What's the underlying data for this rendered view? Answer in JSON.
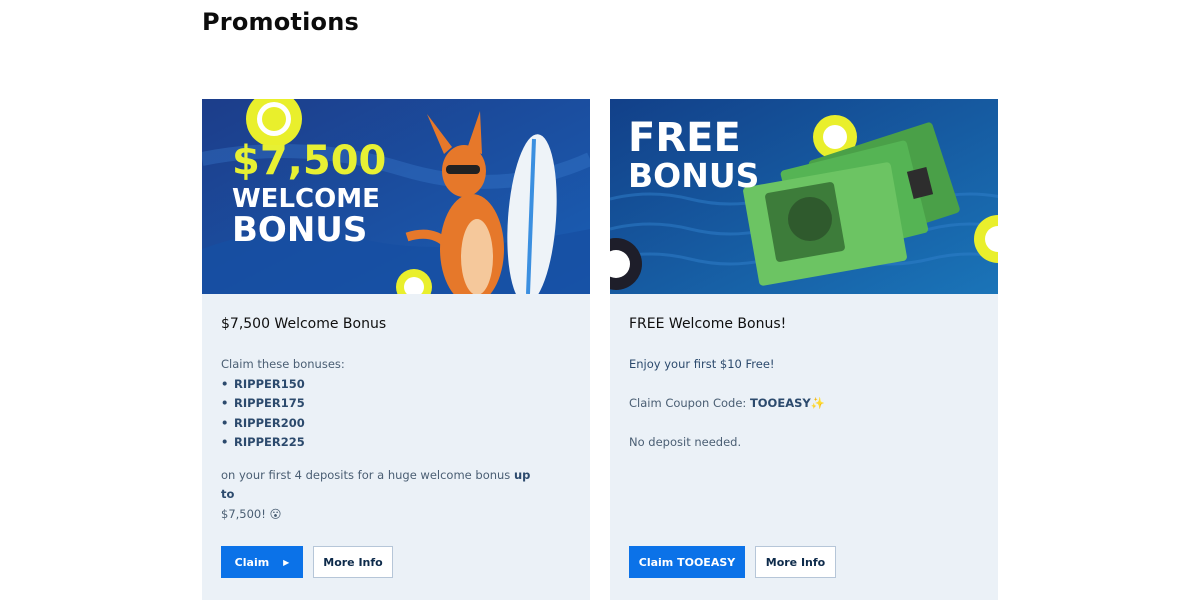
{
  "page": {
    "title": "Promotions"
  },
  "promotions": [
    {
      "banner": {
        "amount": "$7,500",
        "line1": "WELCOME",
        "line2": "BONUS",
        "colors": {
          "bg": "#1b3f8c",
          "amount": "#e7f033",
          "text": "#ffffff",
          "kangaroo": "#e6782a"
        }
      },
      "title": "$7,500 Welcome Bonus",
      "intro": "Claim these bonuses:",
      "codes": [
        "RIPPER150",
        "RIPPER175",
        "RIPPER200",
        "RIPPER225"
      ],
      "outro_pre": "on your first 4 deposits for a huge welcome bonus ",
      "outro_bold": "up to",
      "outro_post": "$7,500! 😮",
      "primary_button": "Claim",
      "primary_icon": "chevron-right-icon",
      "secondary_button": "More Info"
    },
    {
      "banner": {
        "line1": "FREE",
        "line2": "BONUS",
        "colors": {
          "bg": "#13407a",
          "text": "#ffffff",
          "cash": "#5fbf5a"
        }
      },
      "title": "FREE Welcome Bonus!",
      "line1": "Enjoy your first $10 Free!",
      "coupon_label": "Claim Coupon Code: ",
      "coupon_code": "TOOEASY",
      "coupon_emoji": "✨",
      "line3": "No deposit needed.",
      "primary_button": "Claim TOOEASY",
      "secondary_button": "More Info"
    }
  ],
  "colors": {
    "accent": "#0b72e8",
    "card_bg": "#ebf1f7",
    "code_text": "#2c4a6d"
  }
}
